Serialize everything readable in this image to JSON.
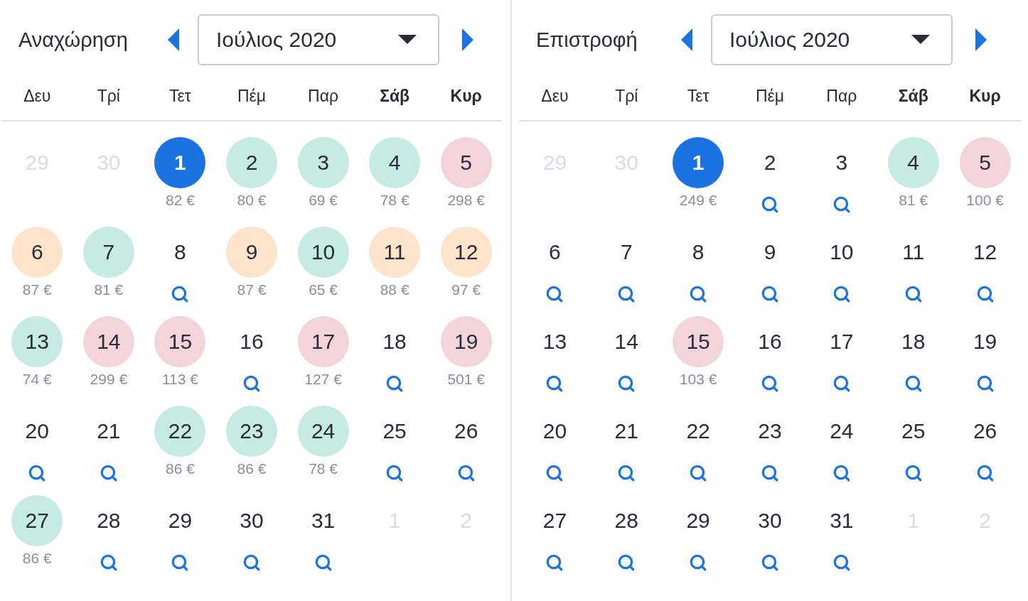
{
  "calendars": [
    {
      "title": "Αναχώρηση",
      "month": "Ιούλιος 2020",
      "weekdays": [
        {
          "label": "Δευ",
          "weekend": false
        },
        {
          "label": "Τρί",
          "weekend": false
        },
        {
          "label": "Τετ",
          "weekend": false
        },
        {
          "label": "Πέμ",
          "weekend": false
        },
        {
          "label": "Παρ",
          "weekend": false
        },
        {
          "label": "Σάβ",
          "weekend": true
        },
        {
          "label": "Κυρ",
          "weekend": true
        }
      ],
      "days": [
        {
          "day": "29",
          "kind": "outside",
          "selected": false
        },
        {
          "day": "30",
          "kind": "outside",
          "selected": false
        },
        {
          "day": "1",
          "kind": "price",
          "price": "82 €",
          "selected": true
        },
        {
          "day": "2",
          "kind": "price",
          "price": "80 €",
          "color": "#c6ebe4",
          "selected": false
        },
        {
          "day": "3",
          "kind": "price",
          "price": "69 €",
          "color": "#c6ebe4",
          "selected": false
        },
        {
          "day": "4",
          "kind": "price",
          "price": "78 €",
          "color": "#c6ebe4",
          "selected": false
        },
        {
          "day": "5",
          "kind": "price",
          "price": "298 €",
          "color": "#f3d4da",
          "selected": false
        },
        {
          "day": "6",
          "kind": "price",
          "price": "87 €",
          "color": "#fee4cb",
          "selected": false
        },
        {
          "day": "7",
          "kind": "price",
          "price": "81 €",
          "color": "#c6ebe4",
          "selected": false
        },
        {
          "day": "8",
          "kind": "search",
          "selected": false
        },
        {
          "day": "9",
          "kind": "price",
          "price": "87 €",
          "color": "#fee4cb",
          "selected": false
        },
        {
          "day": "10",
          "kind": "price",
          "price": "65 €",
          "color": "#c6ebe4",
          "selected": false
        },
        {
          "day": "11",
          "kind": "price",
          "price": "88 €",
          "color": "#fee4cb",
          "selected": false
        },
        {
          "day": "12",
          "kind": "price",
          "price": "97 €",
          "color": "#fee4cb",
          "selected": false
        },
        {
          "day": "13",
          "kind": "price",
          "price": "74 €",
          "color": "#c6ebe4",
          "selected": false
        },
        {
          "day": "14",
          "kind": "price",
          "price": "299 €",
          "color": "#f3d4da",
          "selected": false
        },
        {
          "day": "15",
          "kind": "price",
          "price": "113 €",
          "color": "#f3d4da",
          "selected": false
        },
        {
          "day": "16",
          "kind": "search",
          "selected": false
        },
        {
          "day": "17",
          "kind": "price",
          "price": "127 €",
          "color": "#f3d4da",
          "selected": false
        },
        {
          "day": "18",
          "kind": "search",
          "selected": false
        },
        {
          "day": "19",
          "kind": "price",
          "price": "501 €",
          "color": "#f3d4da",
          "selected": false
        },
        {
          "day": "20",
          "kind": "search",
          "selected": false
        },
        {
          "day": "21",
          "kind": "search",
          "selected": false
        },
        {
          "day": "22",
          "kind": "price",
          "price": "86 €",
          "color": "#c6ebe4",
          "selected": false
        },
        {
          "day": "23",
          "kind": "price",
          "price": "86 €",
          "color": "#c6ebe4",
          "selected": false
        },
        {
          "day": "24",
          "kind": "price",
          "price": "78 €",
          "color": "#c6ebe4",
          "selected": false
        },
        {
          "day": "25",
          "kind": "search",
          "selected": false
        },
        {
          "day": "26",
          "kind": "search",
          "selected": false
        },
        {
          "day": "27",
          "kind": "price",
          "price": "86 €",
          "color": "#c6ebe4",
          "selected": false
        },
        {
          "day": "28",
          "kind": "search",
          "selected": false
        },
        {
          "day": "29",
          "kind": "search",
          "selected": false
        },
        {
          "day": "30",
          "kind": "search",
          "selected": false
        },
        {
          "day": "31",
          "kind": "search",
          "selected": false
        },
        {
          "day": "1",
          "kind": "outside",
          "selected": false
        },
        {
          "day": "2",
          "kind": "outside",
          "selected": false
        }
      ]
    },
    {
      "title": "Επιστροφή",
      "month": "Ιούλιος 2020",
      "weekdays": [
        {
          "label": "Δευ",
          "weekend": false
        },
        {
          "label": "Τρί",
          "weekend": false
        },
        {
          "label": "Τετ",
          "weekend": false
        },
        {
          "label": "Πέμ",
          "weekend": false
        },
        {
          "label": "Παρ",
          "weekend": false
        },
        {
          "label": "Σάβ",
          "weekend": true
        },
        {
          "label": "Κυρ",
          "weekend": true
        }
      ],
      "days": [
        {
          "day": "29",
          "kind": "outside",
          "selected": false
        },
        {
          "day": "30",
          "kind": "outside",
          "selected": false
        },
        {
          "day": "1",
          "kind": "price",
          "price": "249 €",
          "selected": true
        },
        {
          "day": "2",
          "kind": "search",
          "selected": false
        },
        {
          "day": "3",
          "kind": "search",
          "selected": false
        },
        {
          "day": "4",
          "kind": "price",
          "price": "81 €",
          "color": "#c6ebe4",
          "selected": false
        },
        {
          "day": "5",
          "kind": "price",
          "price": "100 €",
          "color": "#f3d4da",
          "selected": false
        },
        {
          "day": "6",
          "kind": "search",
          "selected": false
        },
        {
          "day": "7",
          "kind": "search",
          "selected": false
        },
        {
          "day": "8",
          "kind": "search",
          "selected": false
        },
        {
          "day": "9",
          "kind": "search",
          "selected": false
        },
        {
          "day": "10",
          "kind": "search",
          "selected": false
        },
        {
          "day": "11",
          "kind": "search",
          "selected": false
        },
        {
          "day": "12",
          "kind": "search",
          "selected": false
        },
        {
          "day": "13",
          "kind": "search",
          "selected": false
        },
        {
          "day": "14",
          "kind": "search",
          "selected": false
        },
        {
          "day": "15",
          "kind": "price",
          "price": "103 €",
          "color": "#f3d4da",
          "selected": false
        },
        {
          "day": "16",
          "kind": "search",
          "selected": false
        },
        {
          "day": "17",
          "kind": "search",
          "selected": false
        },
        {
          "day": "18",
          "kind": "search",
          "selected": false
        },
        {
          "day": "19",
          "kind": "search",
          "selected": false
        },
        {
          "day": "20",
          "kind": "search",
          "selected": false
        },
        {
          "day": "21",
          "kind": "search",
          "selected": false
        },
        {
          "day": "22",
          "kind": "search",
          "selected": false
        },
        {
          "day": "23",
          "kind": "search",
          "selected": false
        },
        {
          "day": "24",
          "kind": "search",
          "selected": false
        },
        {
          "day": "25",
          "kind": "search",
          "selected": false
        },
        {
          "day": "26",
          "kind": "search",
          "selected": false
        },
        {
          "day": "27",
          "kind": "search",
          "selected": false
        },
        {
          "day": "28",
          "kind": "search",
          "selected": false
        },
        {
          "day": "29",
          "kind": "search",
          "selected": false
        },
        {
          "day": "30",
          "kind": "search",
          "selected": false
        },
        {
          "day": "31",
          "kind": "search",
          "selected": false
        },
        {
          "day": "1",
          "kind": "outside",
          "selected": false
        },
        {
          "day": "2",
          "kind": "outside",
          "selected": false
        }
      ]
    }
  ]
}
